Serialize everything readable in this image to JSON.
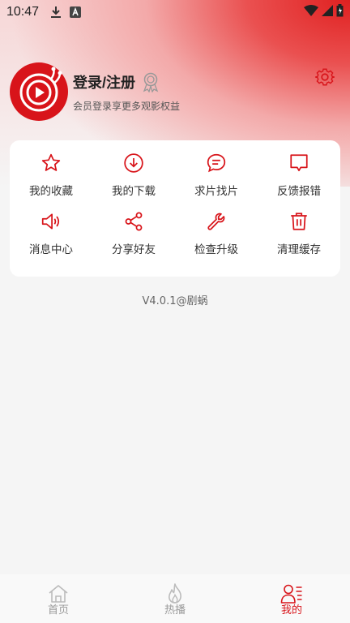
{
  "status_bar": {
    "time": "10:47"
  },
  "colors": {
    "accent": "#d8141a",
    "text": "#333333",
    "muted": "#999999"
  },
  "profile": {
    "title": "登录/注册",
    "subtitle": "会员登录享更多观影权益"
  },
  "grid": {
    "items": [
      {
        "label": "我的收藏",
        "icon": "star-icon"
      },
      {
        "label": "我的下载",
        "icon": "download-icon"
      },
      {
        "label": "求片找片",
        "icon": "chat-bubble-icon"
      },
      {
        "label": "反馈报错",
        "icon": "feedback-icon"
      },
      {
        "label": "消息中心",
        "icon": "speaker-icon"
      },
      {
        "label": "分享好友",
        "icon": "share-icon"
      },
      {
        "label": "检查升级",
        "icon": "wrench-icon"
      },
      {
        "label": "清理缓存",
        "icon": "trash-icon"
      }
    ]
  },
  "version": "V4.0.1@剧蜗",
  "tabs": [
    {
      "label": "首页",
      "icon": "home-icon",
      "active": false
    },
    {
      "label": "热播",
      "icon": "flame-icon",
      "active": false
    },
    {
      "label": "我的",
      "icon": "profile-icon",
      "active": true
    }
  ]
}
